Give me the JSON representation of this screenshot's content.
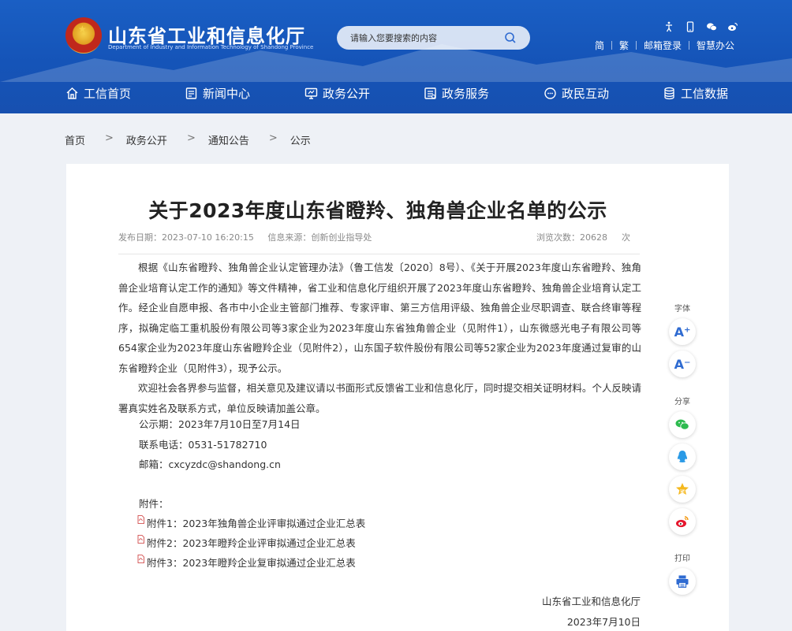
{
  "header": {
    "site_title": "山东省工业和信息化厅",
    "site_subtitle": "Department of Industry and Information Technology of Shandong Province",
    "search_placeholder": "请输入您要搜索的内容",
    "top_icons": [
      "accessibility-icon",
      "mobile-icon",
      "wechat-icon",
      "weibo-icon"
    ],
    "links": [
      "简",
      "繁",
      "邮箱登录",
      "智慧办公"
    ]
  },
  "nav": [
    {
      "label": "工信首页",
      "icon": "home-icon"
    },
    {
      "label": "新闻中心",
      "icon": "news-icon"
    },
    {
      "label": "政务公开",
      "icon": "monitor-icon"
    },
    {
      "label": "政务服务",
      "icon": "service-icon"
    },
    {
      "label": "政民互动",
      "icon": "interaction-icon"
    },
    {
      "label": "工信数据",
      "icon": "database-icon"
    }
  ],
  "breadcrumb": [
    "首页",
    "政务公开",
    "通知公告",
    "公示"
  ],
  "breadcrumb_sep": ">",
  "article": {
    "title": "关于2023年度山东省瞪羚、独角兽企业名单的公示",
    "publish_date": "发布日期：2023-07-10 16:20:15",
    "source": "信息来源：创新创业指导处",
    "views_label": "浏览次数：",
    "views": "20628",
    "views_unit": "次",
    "paragraph1": "根据《山东省瞪羚、独角兽企业认定管理办法》（鲁工信发〔2020〕8号）、《关于开展2023年度山东省瞪羚、独角兽企业培育认定工作的通知》等文件精神，省工业和信息化厅组织开展了2023年度山东省瞪羚、独角兽企业培育认定工作。经企业自愿申报、各市中小企业主管部门推荐、专家评审、第三方信用评级、独角兽企业尽职调查、联合终审等程序，拟确定临工重机股份有限公司等3家企业为2023年度山东省独角兽企业（见附件1），山东微感光电子有限公司等654家企业为2023年度山东省瞪羚企业（见附件2），山东国子软件股份有限公司等52家企业为2023年度通过复审的山东省瞪羚企业（见附件3），现予公示。",
    "paragraph2": "欢迎社会各界参与监督，相关意见及建议请以书面形式反馈省工业和信息化厅，同时提交相关证明材料。个人反映请署真实姓名及联系方式，单位反映请加盖公章。",
    "period": "公示期：2023年7月10日至7月14日",
    "phone": "联系电话：0531-51782710",
    "email": "邮箱：cxcyzdc@shandong.cn",
    "attachments_label": "附件：",
    "attachments": [
      "附件1：2023年独角兽企业评审拟通过企业汇总表",
      "附件2：2023年瞪羚企业评审拟通过企业汇总表",
      "附件3：2023年瞪羚企业复审拟通过企业汇总表"
    ],
    "signature_org": "山东省工业和信息化厅",
    "signature_date": "2023年7月10日"
  },
  "side_tools": {
    "font_label": "字体",
    "font_increase": "A⁺",
    "font_decrease": "A⁻",
    "share_label": "分享",
    "share_icons": [
      "wechat-share-icon",
      "qq-share-icon",
      "qzone-share-icon",
      "weibo-share-icon"
    ],
    "print_label": "打印"
  },
  "colors": {
    "header_blue": "#1554b8",
    "accent_blue": "#2f6bd1",
    "page_bg": "#eef1f6"
  }
}
